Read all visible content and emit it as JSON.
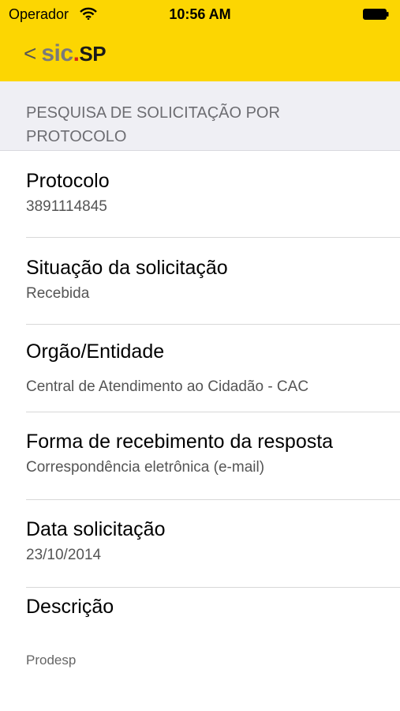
{
  "status_bar": {
    "carrier": "Operador",
    "time": "10:56 AM",
    "icons": [
      "wifi-icon",
      "battery-icon"
    ]
  },
  "nav": {
    "back_glyph": "<",
    "logo": {
      "sic": "sic",
      "dot": ".",
      "sp": "SP"
    },
    "colors": {
      "bar": "#fcd602",
      "logo_sic": "#7a7a7a",
      "logo_dot": "#d9261c"
    }
  },
  "section": {
    "title_line1": "PESQUISA DE SOLICITAÇÃO POR",
    "title_line2": "PROTOCOLO"
  },
  "fields": [
    {
      "label": "Protocolo",
      "value": "3891114845"
    },
    {
      "label": "Situação da solicitação",
      "value": "Recebida"
    },
    {
      "label": "Orgão/Entidade",
      "value": "Central de Atendimento ao Cidadão - CAC"
    },
    {
      "label": "Forma de recebimento da resposta",
      "value": "Correspondência eletrônica (e-mail)"
    },
    {
      "label": "Data solicitação",
      "value": "23/10/2014"
    },
    {
      "label": "Descrição",
      "value": "Prodesp"
    }
  ]
}
